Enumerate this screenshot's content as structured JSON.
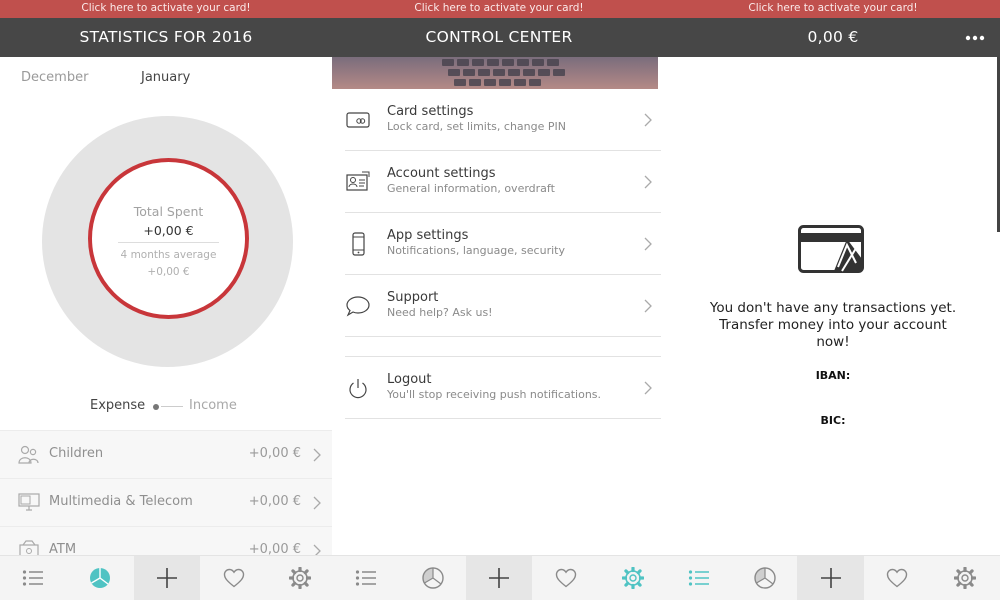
{
  "banner_text": "Click here to activate your card!",
  "colors": {
    "banner": "#c0504d",
    "header": "#474747",
    "accent_teal": "#4fc3c3",
    "donut_ring": "#c8363a"
  },
  "statistics": {
    "title": "STATISTICS FOR 2016",
    "months": {
      "previous": "December",
      "current": "January"
    },
    "donut": {
      "label": "Total Spent",
      "value": "+0,00 €",
      "average_label": "4 months average",
      "average_value": "+0,00 €"
    },
    "toggle": {
      "expense": "Expense",
      "income": "Income",
      "selected": "Expense"
    },
    "categories": [
      {
        "name": "Children",
        "amount": "+0,00 €",
        "icon": "children-icon"
      },
      {
        "name": "Multimedia & Telecom",
        "amount": "+0,00 €",
        "icon": "monitor-icon"
      },
      {
        "name": "ATM",
        "amount": "+0,00 €",
        "icon": "atm-icon"
      }
    ]
  },
  "control_center": {
    "title": "CONTROL CENTER",
    "items": [
      {
        "title": "Card settings",
        "subtitle": "Lock card, set limits, change PIN",
        "icon": "card-icon"
      },
      {
        "title": "Account settings",
        "subtitle": "General information, overdraft",
        "icon": "id-card-icon"
      },
      {
        "title": "App settings",
        "subtitle": "Notifications, language, security",
        "icon": "phone-icon"
      },
      {
        "title": "Support",
        "subtitle": "Need help? Ask us!",
        "icon": "chat-bubble-icon"
      },
      {
        "title": "Logout",
        "subtitle": "You'll stop receiving push notifications.",
        "icon": "power-icon"
      }
    ]
  },
  "transactions": {
    "balance": "0,00 €",
    "more_icon": "more-dots-icon",
    "empty_message_lines": [
      "You don't have any transactions yet.",
      "Transfer money into your account",
      "now!"
    ],
    "iban_label": "IBAN:",
    "bic_label": "BIC:"
  },
  "bottom_bar": {
    "tabs": [
      {
        "icon": "list-icon",
        "active": false
      },
      {
        "icon": "pie-chart-icon",
        "active": true
      },
      {
        "icon": "plus-icon",
        "active": false
      },
      {
        "icon": "heart-icon",
        "active": false
      },
      {
        "icon": "gear-icon",
        "active": false
      },
      {
        "icon": "list-icon",
        "active": false
      },
      {
        "icon": "pie-chart-icon",
        "active": false
      },
      {
        "icon": "plus-icon",
        "active": false
      },
      {
        "icon": "heart-icon",
        "active": false
      },
      {
        "icon": "gear-icon",
        "active": true
      },
      {
        "icon": "list-icon",
        "active": true
      },
      {
        "icon": "pie-chart-icon",
        "active": false
      },
      {
        "icon": "plus-icon",
        "active": false
      },
      {
        "icon": "heart-icon",
        "active": false
      },
      {
        "icon": "gear-icon",
        "active": false
      }
    ]
  }
}
